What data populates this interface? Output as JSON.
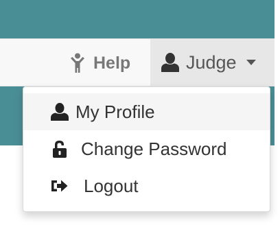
{
  "navbar": {
    "help_label": "Help",
    "user_label": "Judge"
  },
  "user_menu": {
    "items": [
      {
        "label": "My Profile",
        "icon": "user-icon"
      },
      {
        "label": "Change Password",
        "icon": "unlock-icon"
      },
      {
        "label": "Logout",
        "icon": "sign-out-icon"
      }
    ]
  },
  "colors": {
    "header_teal": "#4a8e95",
    "navbar_bg": "#f8f8f8",
    "active_nav_bg": "#e7e7e7",
    "menu_hover_bg": "#f5f5f5",
    "text_dark": "#333333"
  }
}
